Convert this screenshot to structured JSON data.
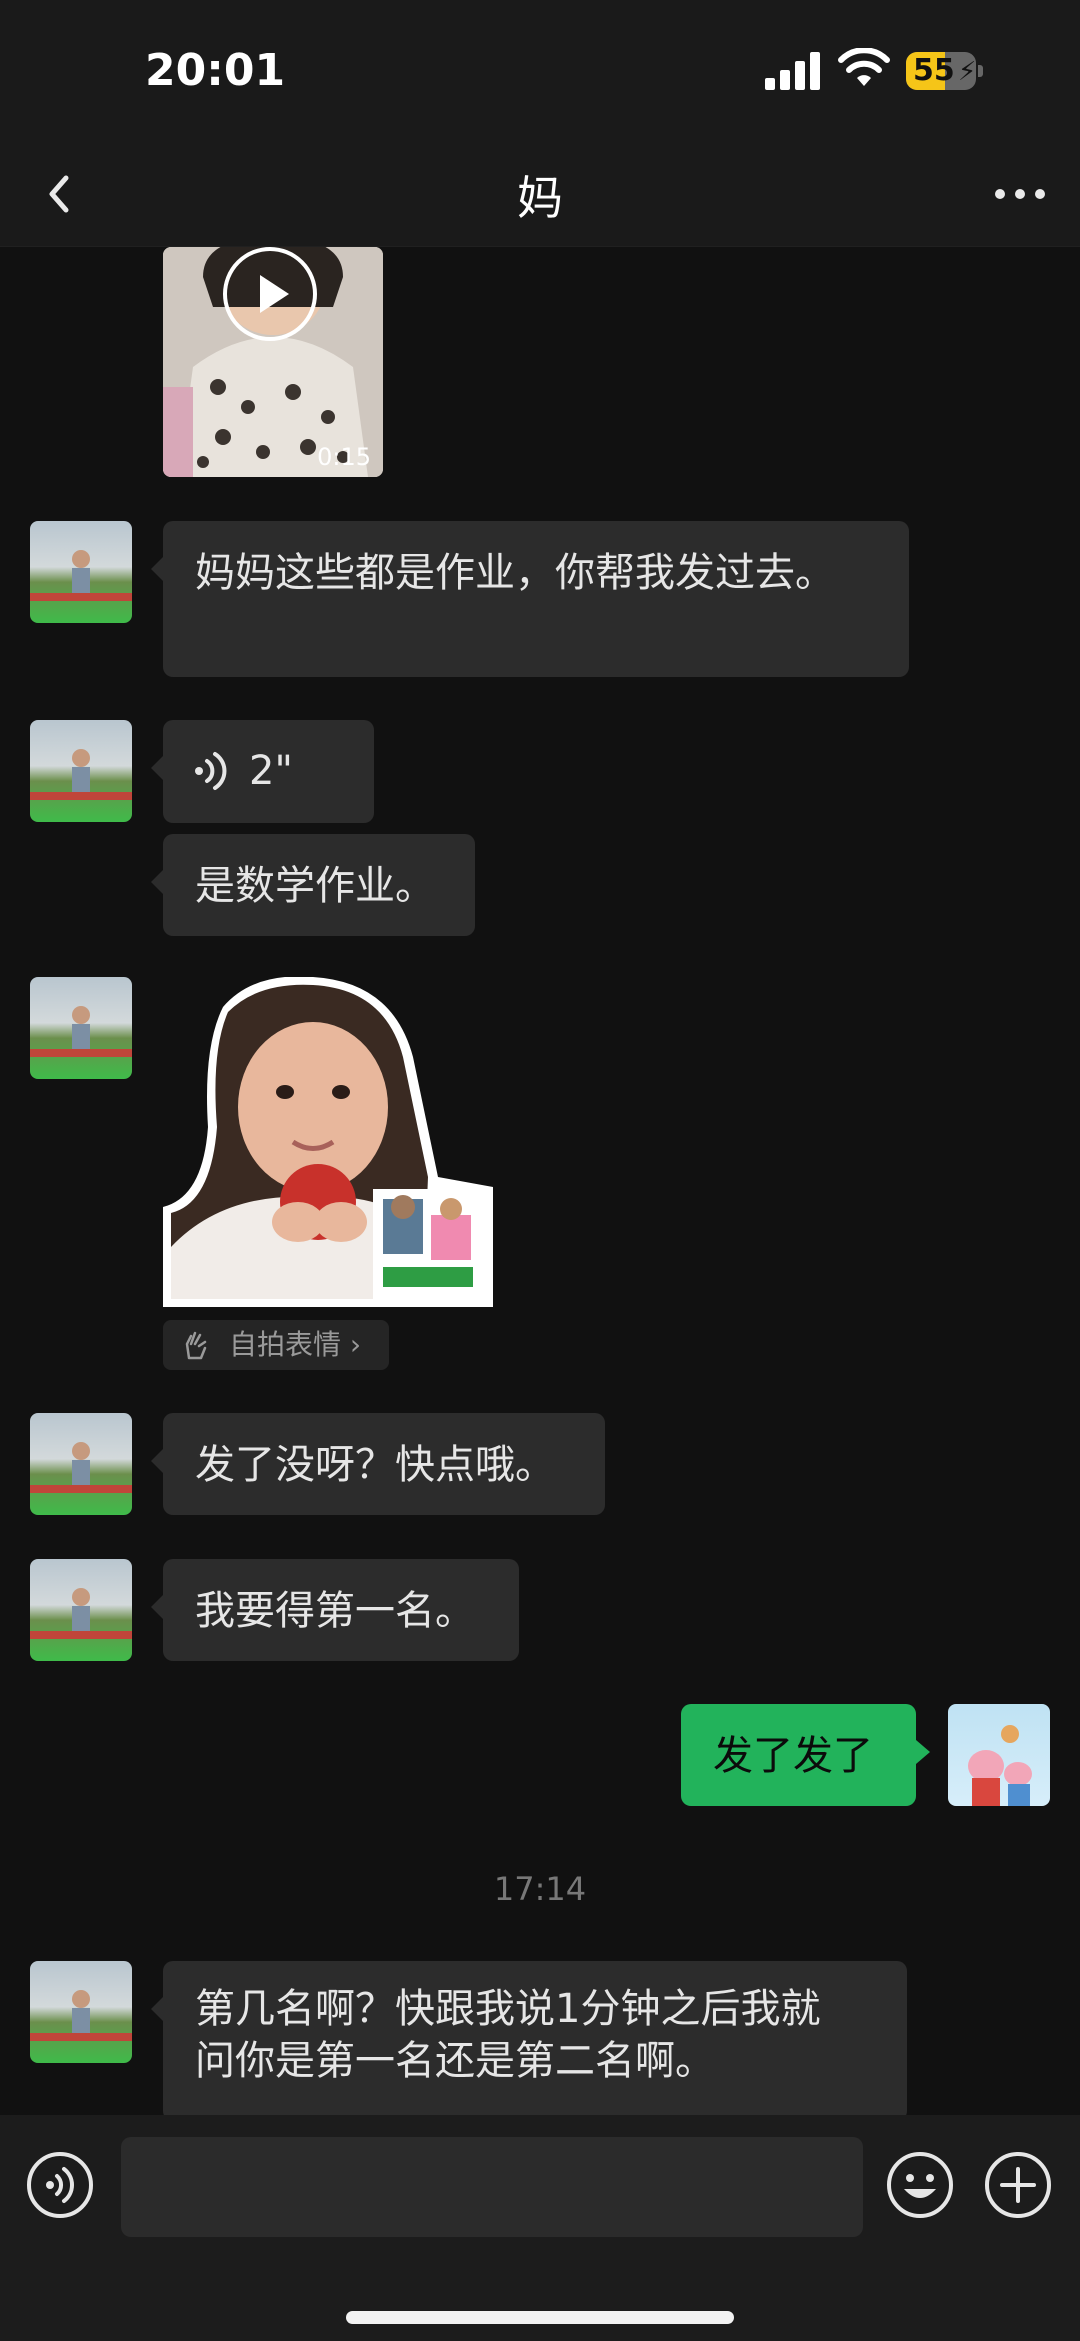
{
  "status": {
    "time": "20:01",
    "battery": "55",
    "battery_level": 0.55
  },
  "header": {
    "title": "妈",
    "back_icon": "chevron-left-icon",
    "more_icon": "more-dots-icon"
  },
  "messages": {
    "video": {
      "duration": "0:15"
    },
    "m1": "妈妈这些都是作业，你帮我发过去。",
    "voice": {
      "duration": "2\""
    },
    "m2": "是数学作业。",
    "selfie_label": "自拍表情",
    "m3": "发了没呀？快点哦。",
    "m4": "我要得第一名。",
    "m5": "发了发了",
    "timestamp": "17:14",
    "m6_line1": "第几名啊？快跟我说1分钟之后我就",
    "m6_line2": "问你是第一名还是第二名啊。"
  },
  "input": {
    "placeholder": ""
  },
  "colors": {
    "sent_bubble": "#22b35b",
    "received_bubble": "#2c2c2c",
    "background": "#111111",
    "battery": "#f5c518"
  }
}
